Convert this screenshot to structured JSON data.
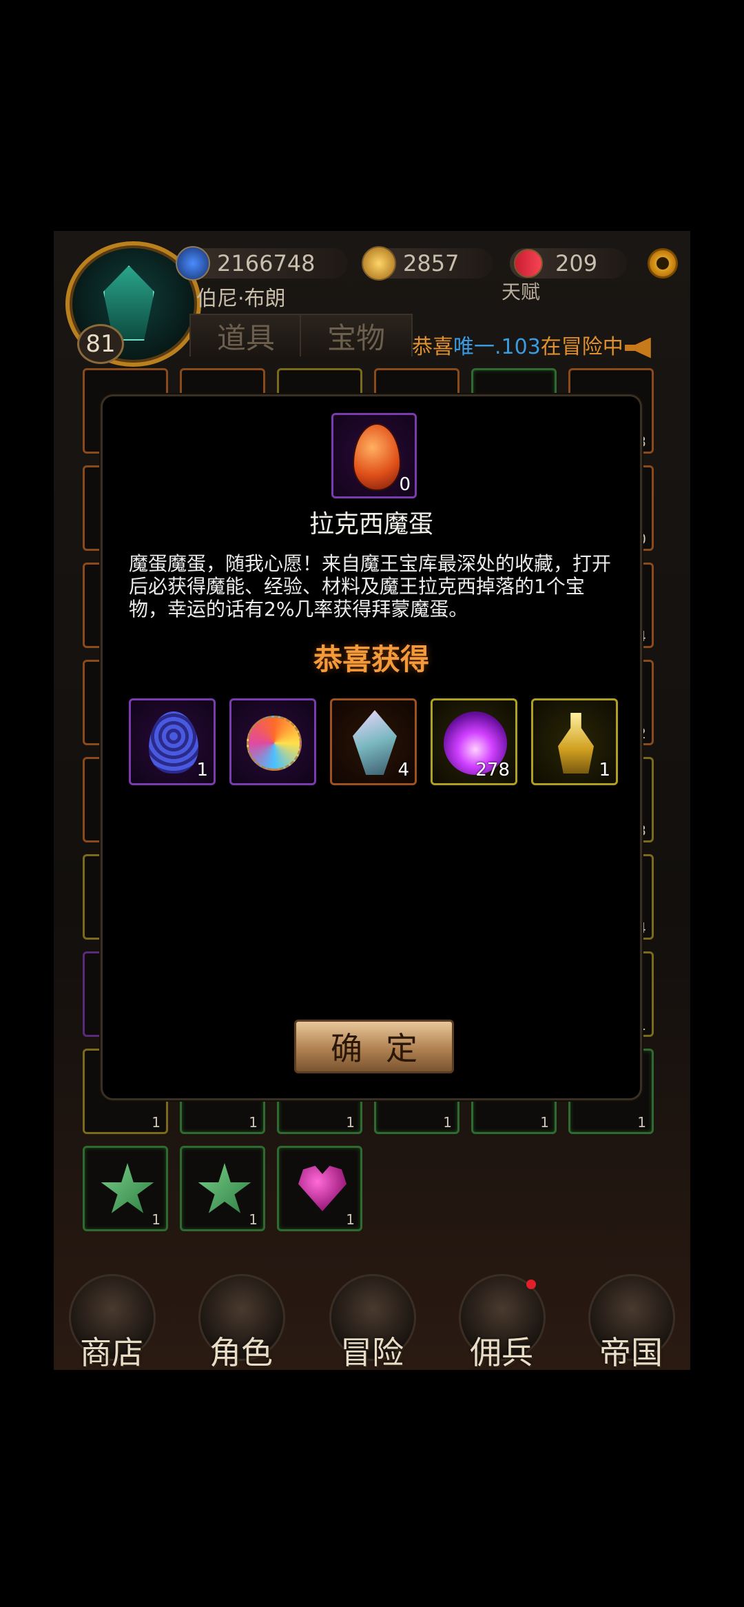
{
  "header": {
    "level": "81",
    "player_name": "伯尼·布朗",
    "diamonds": "2166748",
    "gold": "2857",
    "rubies": "209",
    "talent_label": "天赋",
    "tabs": [
      "道具",
      "宝物"
    ],
    "marquee": {
      "prefix": "恭喜",
      "player": "唯一.103",
      "suffix": "在冒险中"
    }
  },
  "inventory": {
    "visible_counts": [
      "3",
      "0",
      "4",
      "2",
      "3",
      "4",
      "1",
      "1",
      "1",
      "1",
      "1",
      "1",
      "1",
      "1",
      "1",
      "1"
    ]
  },
  "dialog": {
    "item_count": "0",
    "item_title": "拉克西魔蛋",
    "item_description": "魔蛋魔蛋，随我心愿！来自魔王宝库最深处的收藏，打开后必获得魔能、经验、材料及魔王拉克西掉落的1个宝物，幸运的话有2%几率获得拜蒙魔蛋。",
    "congrats_label": "恭喜获得",
    "rewards": [
      {
        "icon": "dragon-egg-icon",
        "count": "1",
        "rarity": "purple"
      },
      {
        "icon": "amulet-icon",
        "count": "",
        "rarity": "purple"
      },
      {
        "icon": "crystal-icon",
        "count": "4",
        "rarity": "orange"
      },
      {
        "icon": "flame-orb-icon",
        "count": "278",
        "rarity": "yellow"
      },
      {
        "icon": "potion-icon",
        "count": "1",
        "rarity": "yellow"
      }
    ],
    "confirm_label": "确定"
  },
  "nav": {
    "items": [
      "商店",
      "角色",
      "冒险",
      "佣兵",
      "帝国"
    ]
  },
  "colors": {
    "accent_orange": "#f39a3a",
    "marquee_highlight": "#3a9be0",
    "rarity_purple": "#7a3ab0",
    "rarity_orange": "#a0521e",
    "rarity_yellow": "#b0a020"
  }
}
